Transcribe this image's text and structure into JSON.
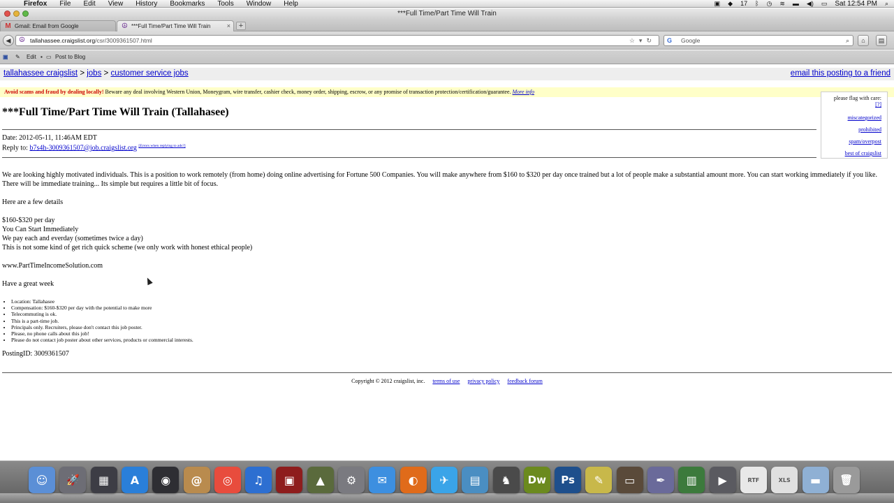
{
  "menubar": {
    "app": "Firefox",
    "menus": [
      "File",
      "Edit",
      "View",
      "History",
      "Bookmarks",
      "Tools",
      "Window",
      "Help"
    ],
    "status_count": "17",
    "clock": "Sat 12:54 PM"
  },
  "window": {
    "title": "***Full Time/Part Time Will Train"
  },
  "tabs": [
    {
      "label": "Gmail: Email from Google"
    },
    {
      "label": "***Full Time/Part Time Will Train"
    }
  ],
  "nav": {
    "url_host": "tallahassee.craigslist.org",
    "url_path": "/csr/3009361507.html",
    "search_placeholder": "Google"
  },
  "bookmarks": {
    "edit_label": "Edit",
    "post_label": "Post to Blog"
  },
  "breadcrumb": {
    "site": "tallahassee craigslist",
    "sep1": ">",
    "cat": "jobs",
    "sep2": ">",
    "subcat": "customer service jobs",
    "email_link": "email this posting to a friend"
  },
  "warning": {
    "bold": "Avoid scams and fraud by dealing locally!",
    "text": "Beware any deal involving Western Union, Moneygram, wire transfer, cashier check, money order, shipping, escrow, or any promise of transaction protection/certification/guarantee.",
    "link": "More info"
  },
  "flag": {
    "header": "please flag with care:",
    "help": "[?]",
    "items": [
      "miscategorized",
      "prohibited",
      "spam/overpost",
      "best of craigslist"
    ]
  },
  "post": {
    "title": "***Full Time/Part Time Will Train (Tallahasee)",
    "date": "Date: 2012-05-11, 11:46AM EDT",
    "reply_label": "Reply to:",
    "reply_email": "b7s4h-3009361507@job.craigslist.org",
    "reply_errors": "[Errors when replying to ads?]",
    "para1": "We are looking highly motivated individuals. This is a position to work remotely (from home) doing online advertising for Fortune 500 Companies. You will make anywhere from $160 to $320 per day once trained but a lot of people make a substantial amount more. You can start working immediately if you like. There will be immediate training... Its simple but requires a little bit of focus.",
    "para2": "Here are a few details",
    "details": [
      "$160-$320 per day",
      "You Can Start Immediately",
      "We pay each and everday (sometimes twice a day)",
      "This is not some kind of get rich quick scheme (we only work with honest ethical people)"
    ],
    "website": "www.PartTimeIncomeSolution.com",
    "closing": "Have a great week",
    "attributes": [
      "Location: Tallahasee",
      "Compensation: $160-$320 per day with the potential to make more",
      "Telecommuting is ok.",
      "This is a part-time job.",
      "Principals only. Recruiters, please don't contact this job poster.",
      "Please, no phone calls about this job!",
      "Please do not contact job poster about other services, products or commercial interests."
    ],
    "posting_id": "PostingID: 3009361507"
  },
  "footer": {
    "copyright": "Copyright © 2012 craigslist, inc.",
    "links": [
      "terms of use",
      "privacy policy",
      "feedback forum"
    ]
  },
  "dock": {
    "icons": [
      {
        "name": "finder-icon",
        "color": "#5b8fd6",
        "glyph": "☺"
      },
      {
        "name": "launchpad-icon",
        "color": "#6d6d75",
        "glyph": "🚀"
      },
      {
        "name": "mission-control-icon",
        "color": "#3d3d45",
        "glyph": "▦"
      },
      {
        "name": "app-store-icon",
        "color": "#2a7fd9",
        "glyph": "A"
      },
      {
        "name": "facetime-icon",
        "color": "#2e2e33",
        "glyph": "◉"
      },
      {
        "name": "address-book-icon",
        "color": "#b98b4e",
        "glyph": "@"
      },
      {
        "name": "chrome-icon",
        "color": "#e84c3d",
        "glyph": "◎"
      },
      {
        "name": "itunes-icon",
        "color": "#2d6fd1",
        "glyph": "♫"
      },
      {
        "name": "photo-booth-icon",
        "color": "#8e1d1d",
        "glyph": "▣"
      },
      {
        "name": "iphoto-icon",
        "color": "#5a6a3c",
        "glyph": "▲"
      },
      {
        "name": "system-preferences-icon",
        "color": "#7a7a80",
        "glyph": "⚙"
      },
      {
        "name": "mail-stamp-icon",
        "color": "#3d8fe0",
        "glyph": "✉"
      },
      {
        "name": "firefox-icon",
        "color": "#e06b1a",
        "glyph": "◐"
      },
      {
        "name": "twitter-icon",
        "color": "#3aa4e8",
        "glyph": "✈"
      },
      {
        "name": "preview-icon",
        "color": "#4a8ec2",
        "glyph": "▤"
      },
      {
        "name": "game-icon",
        "color": "#4a4a4a",
        "glyph": "♞"
      },
      {
        "name": "dreamweaver-icon",
        "color": "#6b8a1e",
        "glyph": "Dw"
      },
      {
        "name": "photoshop-icon",
        "color": "#1e4f8c",
        "glyph": "Ps"
      },
      {
        "name": "pencil-app-icon",
        "color": "#c8b84a",
        "glyph": "✎"
      },
      {
        "name": "keynote-icon",
        "color": "#5a4a3a",
        "glyph": "▭"
      },
      {
        "name": "script-editor-icon",
        "color": "#6a6a9a",
        "glyph": "✒"
      },
      {
        "name": "numbers-icon",
        "color": "#3c7a3c",
        "glyph": "▥"
      },
      {
        "name": "video-icon",
        "color": "#5a5a60",
        "glyph": "▶"
      },
      {
        "name": "rtf-document-icon",
        "color": "#e8e8e8",
        "glyph": "RTF"
      },
      {
        "name": "xls-document-icon",
        "color": "#e0e0e0",
        "glyph": "XLS"
      },
      {
        "name": "folder-icon",
        "color": "#8fb0d4",
        "glyph": "▬"
      },
      {
        "name": "trash-icon",
        "color": "#9a9a9a",
        "glyph": "🗑"
      }
    ]
  }
}
